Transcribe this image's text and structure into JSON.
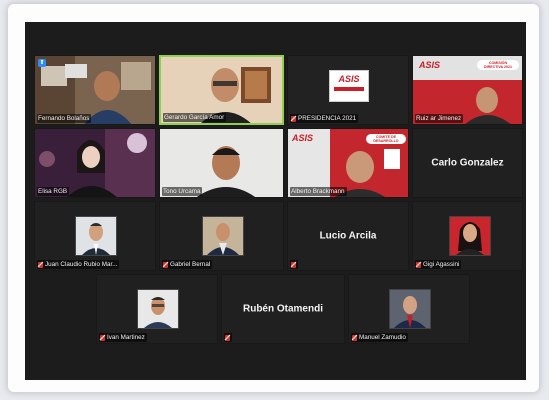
{
  "meeting": {
    "layout": "gallery-view",
    "accent_color": "#8fd14f",
    "mute_color": "#d2312c"
  },
  "participants": [
    {
      "name": "Fernando Bolaños",
      "muted": false,
      "pinned": true
    },
    {
      "name": "Gerardo García Amor",
      "muted": false,
      "active_speaker": true
    },
    {
      "name": "PRESIDENCIA 2021",
      "muted": true,
      "logo_text": "ASIS"
    },
    {
      "name": "Ruiz ar Jimenez",
      "muted": false,
      "logo_text": "ASIS",
      "banner_text": "COMISIÓN DIRECTIVA 2021"
    },
    {
      "name": "Elisa RGB",
      "muted": false
    },
    {
      "name": "Tono Urcama",
      "muted": false
    },
    {
      "name": "Alberto Brackmann",
      "muted": false,
      "logo_text": "ASIS",
      "banner_text": "COMITÉ DE DESARROLLO"
    },
    {
      "name": "Carlo Gonzalez",
      "muted": false,
      "display": "name-only"
    },
    {
      "name": "Juan Claudio Rubio Mar...",
      "muted": true
    },
    {
      "name": "Gabriel Bernal",
      "muted": true
    },
    {
      "name": "Lucio Arcila",
      "muted": true,
      "display": "name-only"
    },
    {
      "name": "Gigi Agassini",
      "muted": true
    },
    {
      "name": "Ivan Martinez",
      "muted": true
    },
    {
      "name": "Rubén Otamendi",
      "muted": true,
      "display": "name-only"
    },
    {
      "name": "Manuel Zamudio",
      "muted": true
    }
  ]
}
